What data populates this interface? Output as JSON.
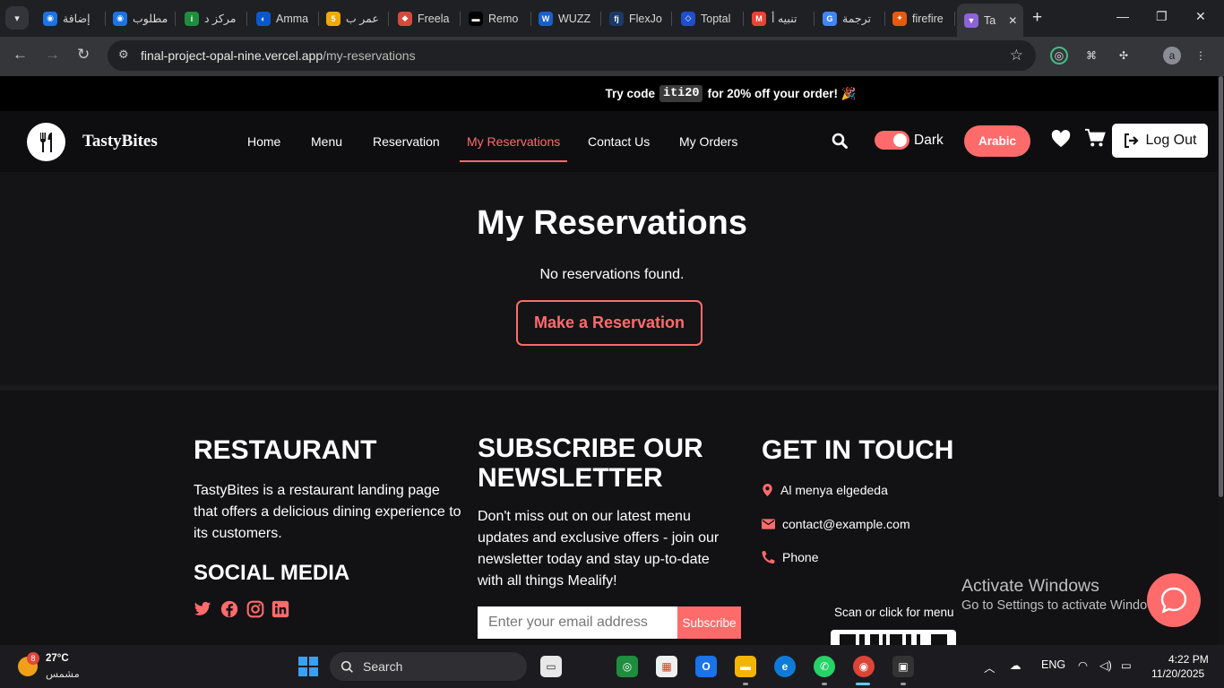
{
  "browser": {
    "tabs": [
      {
        "label": "إضافة",
        "fav_color": "#1a73e8",
        "fav_text": "◉"
      },
      {
        "label": "مطلوب",
        "fav_color": "#1a73e8",
        "fav_text": "◉"
      },
      {
        "label": "مركز د",
        "fav_color": "#1e8e3e",
        "fav_text": "i"
      },
      {
        "label": "Amma",
        "fav_color": "#0b57d0",
        "fav_text": "◐"
      },
      {
        "label": "عمر ب",
        "fav_color": "#f2a900",
        "fav_text": "5"
      },
      {
        "label": "Freela",
        "fav_color": "#d64a3b",
        "fav_text": "◆"
      },
      {
        "label": "Remo",
        "fav_color": "#000000",
        "fav_text": "▬"
      },
      {
        "label": "WUZZ",
        "fav_color": "#1a5fd0",
        "fav_text": "W"
      },
      {
        "label": "FlexJo",
        "fav_color": "#1b3a67",
        "fav_text": "fj"
      },
      {
        "label": "Toptal",
        "fav_color": "#204ecf",
        "fav_text": "◇"
      },
      {
        "label": "تنبيه أ",
        "fav_color": "#ea4335",
        "fav_text": "M"
      },
      {
        "label": "ترجمة",
        "fav_color": "#4285f4",
        "fav_text": "G"
      },
      {
        "label": "firefire",
        "fav_color": "#e8590c",
        "fav_text": "✦"
      },
      {
        "label": "Ta",
        "fav_color": "#8e63d6",
        "fav_text": "▼"
      }
    ],
    "address": {
      "host": "final-project-opal-nine.vercel.app",
      "path": "/my-reservations"
    },
    "profile_initial": "a"
  },
  "promo": {
    "prefix": "Try code",
    "code": "iti20",
    "suffix": "for 20% off your order! 🎉"
  },
  "nav": {
    "brand": "TastyBites",
    "links": [
      "Home",
      "Menu",
      "Reservation",
      "My Reservations",
      "Contact Us",
      "My Orders"
    ],
    "active_link": "My Reservations",
    "theme_label": "Dark",
    "language_button": "Arabic",
    "logout_button": "Log Out",
    "accent_color": "#ff6b6b"
  },
  "main": {
    "title": "My Reservations",
    "empty_message": "No reservations found.",
    "cta_button": "Make a Reservation"
  },
  "footer": {
    "restaurant": {
      "heading": "RESTAURANT",
      "description": "TastyBites is a restaurant landing page that offers a delicious dining experience to its customers."
    },
    "social": {
      "heading": "SOCIAL MEDIA",
      "icons": [
        "twitter-icon",
        "facebook-icon",
        "instagram-icon",
        "linkedin-icon"
      ]
    },
    "newsletter": {
      "heading_line1": "SUBSCRIBE OUR",
      "heading_line2": "NEWSLETTER",
      "text": "Don't miss out on our latest menu updates and exclusive offers - join our newsletter today and stay up-to-date with all things Mealify!",
      "placeholder": "Enter your email address",
      "button": "Subscribe"
    },
    "contact": {
      "heading": "GET IN TOUCH",
      "address": "Al menya elgededa",
      "email": "contact@example.com",
      "phone": "Phone",
      "qr_label": "Scan or click for menu"
    }
  },
  "os": {
    "watermark_title": "Activate Windows",
    "watermark_sub": "Go to Settings to activate Windows.",
    "weather_temp": "27°C",
    "weather_cond": "مشمس",
    "weather_badge": "8",
    "search_label": "Search",
    "lang": "ENG",
    "time": "4:22 PM",
    "date": "11/20/2025"
  }
}
